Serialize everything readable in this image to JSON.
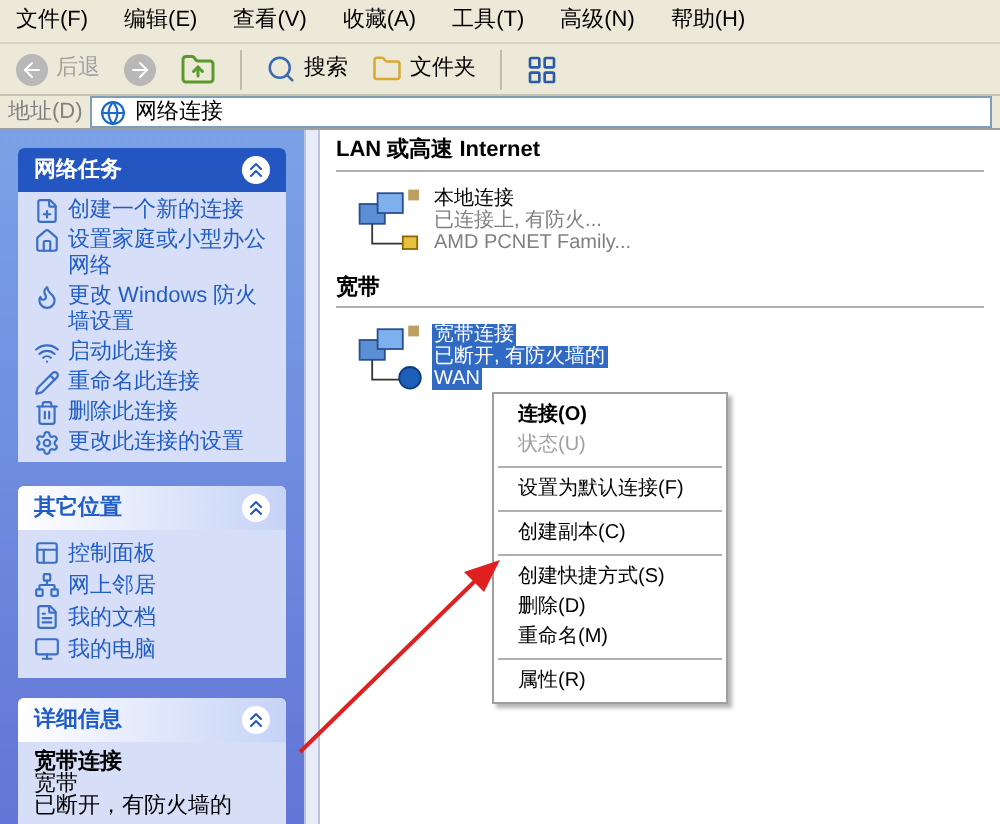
{
  "menu_bar": [
    "文件(F)",
    "编辑(E)",
    "查看(V)",
    "收藏(A)",
    "工具(T)",
    "高级(N)",
    "帮助(H)"
  ],
  "toolbar": {
    "back": {
      "label": "后退",
      "disabled": true
    },
    "search": "搜索",
    "folders": "文件夹"
  },
  "address_bar": {
    "label": "地址(D)",
    "value": "网络连接"
  },
  "sidebar": [
    {
      "title": "网络任务",
      "kind": "tasks",
      "items": [
        "创建一个新的连接",
        "设置家庭或小型办公网络",
        "更改 Windows 防火墙设置",
        "启动此连接",
        "重命名此连接",
        "删除此连接",
        "更改此连接的设置"
      ]
    },
    {
      "title": "其它位置",
      "kind": "places",
      "items": [
        "控制面板",
        "网上邻居",
        "我的文档",
        "我的电脑"
      ]
    },
    {
      "title": "详细信息",
      "kind": "details",
      "name": "宽带连接",
      "lines": [
        "宽带",
        "已断开，有防火墙的"
      ]
    }
  ],
  "groups": [
    {
      "title": "LAN 或高速 Internet",
      "items": [
        {
          "name": "本地连接",
          "lines": [
            "已连接上, 有防火...",
            "AMD PCNET Family..."
          ],
          "selected": false,
          "connected": true
        }
      ]
    },
    {
      "title": "宽带",
      "items": [
        {
          "name": "宽带连接",
          "lines": [
            "已断开, 有防火墙的",
            "WAN"
          ],
          "selected": true,
          "connected": false
        }
      ]
    }
  ],
  "context_menu": [
    {
      "kind": "item",
      "label": "连接(O)",
      "default": true,
      "disabled": false
    },
    {
      "kind": "item",
      "label": "状态(U)",
      "default": false,
      "disabled": true
    },
    {
      "kind": "separator"
    },
    {
      "kind": "item",
      "label": "设置为默认连接(F)",
      "default": false,
      "disabled": false
    },
    {
      "kind": "separator"
    },
    {
      "kind": "item",
      "label": "创建副本(C)",
      "default": false,
      "disabled": false
    },
    {
      "kind": "separator"
    },
    {
      "kind": "item",
      "label": "创建快捷方式(S)",
      "default": false,
      "disabled": false
    },
    {
      "kind": "item",
      "label": "删除(D)",
      "default": false,
      "disabled": false
    },
    {
      "kind": "item",
      "label": "重命名(M)",
      "default": false,
      "disabled": false
    },
    {
      "kind": "separator"
    },
    {
      "kind": "item",
      "label": "属性(R)",
      "default": false,
      "disabled": false
    }
  ]
}
